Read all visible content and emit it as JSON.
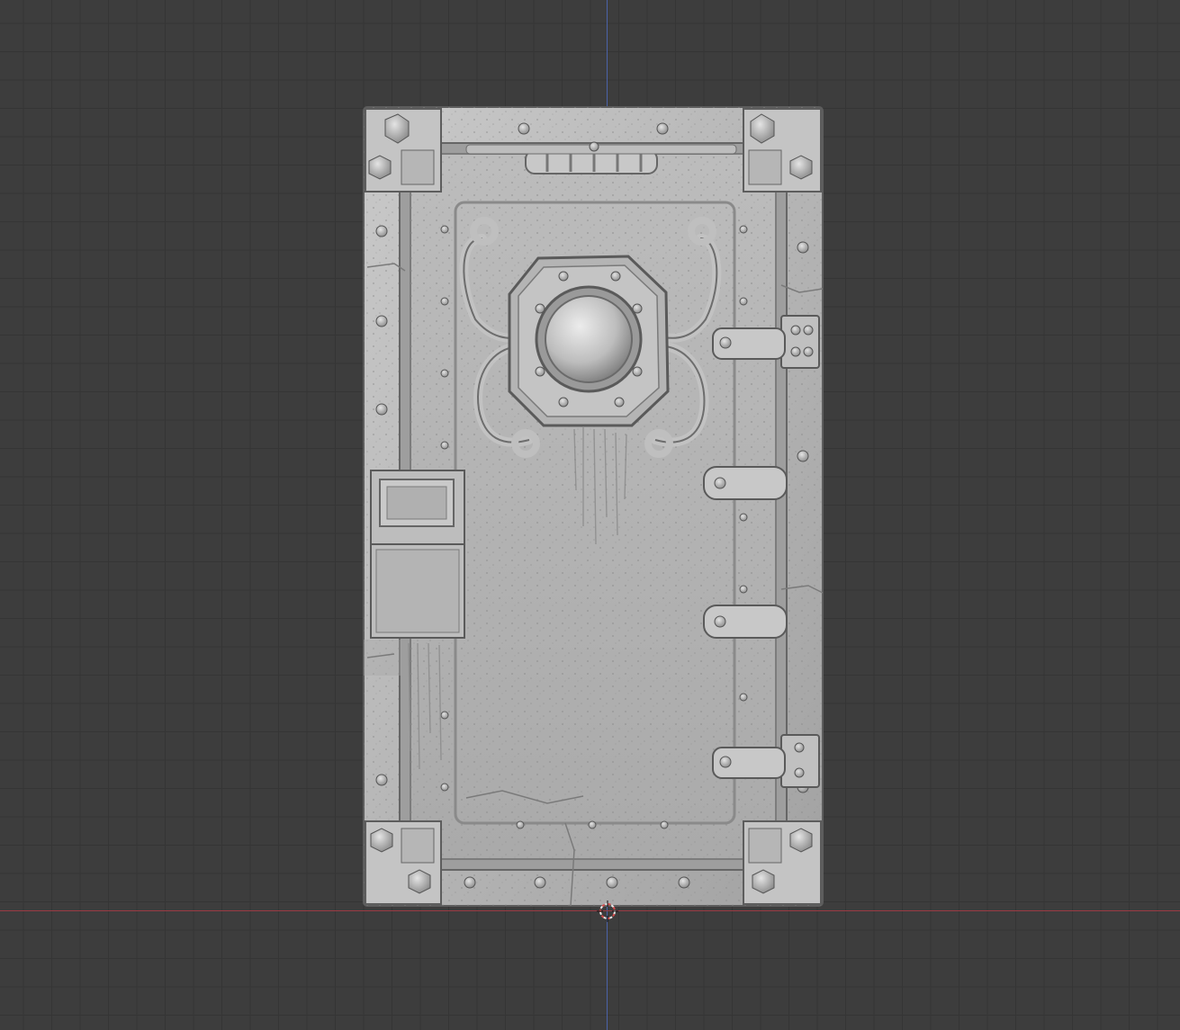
{
  "viewport": {
    "background": "#3d3d3d",
    "grid_color": "#353535",
    "axis_y_color": "#4b62a8",
    "axis_x_color": "#9b3b43"
  },
  "model": {
    "icon": "vault-door-model",
    "material": "matcap-clay",
    "colors": {
      "base": "#b0b0b0",
      "light": "#cfcfcf",
      "dark": "#6a6a6a"
    }
  },
  "cursor": {
    "icon": "3d-cursor-icon",
    "colors": [
      "#e8e8e8",
      "#d24a4a"
    ]
  }
}
